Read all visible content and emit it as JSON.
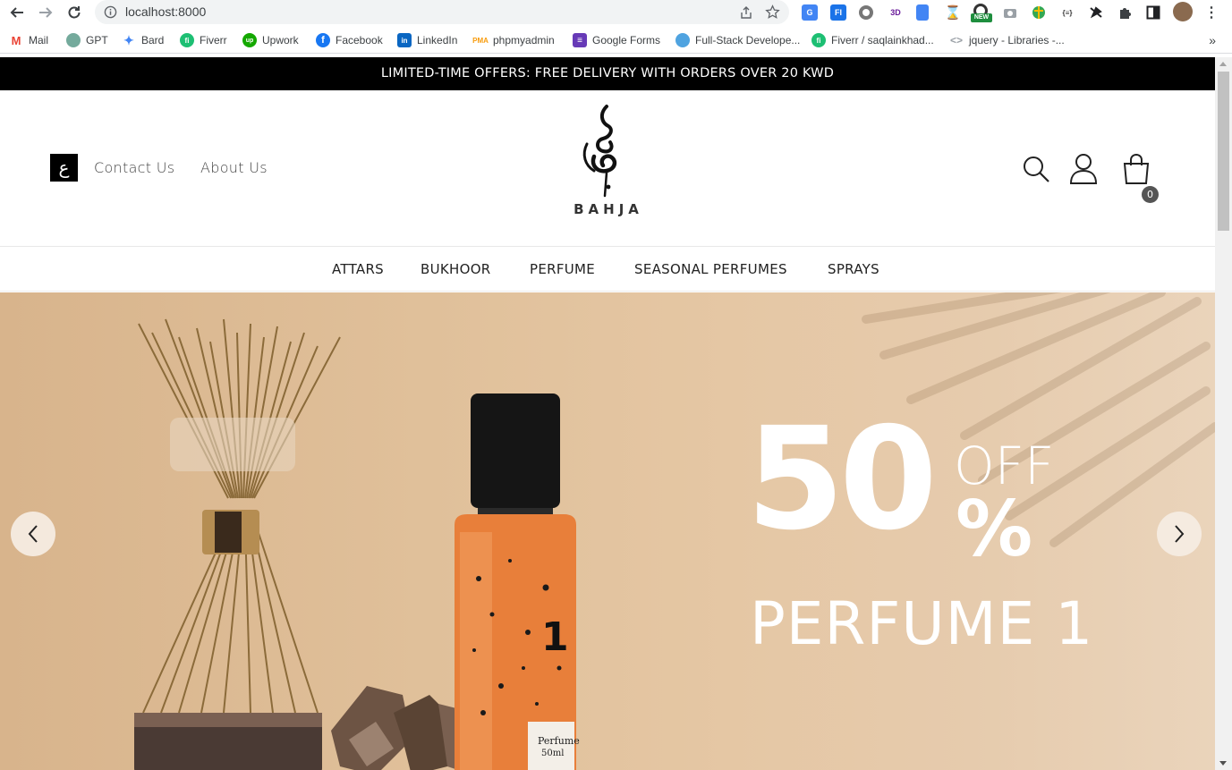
{
  "browser": {
    "url": "localhost:8000",
    "new_badge": "NEW",
    "bookmarks": [
      {
        "label": "Mail",
        "icon": "gmail-icon",
        "color": "#ea4335"
      },
      {
        "label": "GPT",
        "icon": "chatgpt-icon",
        "color": "#74aa9c"
      },
      {
        "label": "Bard",
        "icon": "bard-icon",
        "color": "#4285f4"
      },
      {
        "label": "Fiverr",
        "icon": "fiverr-icon",
        "color": "#1dbf73"
      },
      {
        "label": "Upwork",
        "icon": "upwork-icon",
        "color": "#14a800"
      },
      {
        "label": "Facebook",
        "icon": "facebook-icon",
        "color": "#1877f2"
      },
      {
        "label": "LinkedIn",
        "icon": "linkedin-icon",
        "color": "#0a66c2"
      },
      {
        "label": "phpmyadmin",
        "icon": "phpmyadmin-icon",
        "color": "#f89c0e"
      },
      {
        "label": "Google Forms",
        "icon": "google-forms-icon",
        "color": "#673ab7"
      },
      {
        "label": "Full-Stack Develope...",
        "icon": "cloud-icon",
        "color": "#4fa3e0"
      },
      {
        "label": "Fiverr / saqlainkhad...",
        "icon": "fiverr-icon",
        "color": "#1dbf73"
      },
      {
        "label": "jquery - Libraries -...",
        "icon": "code-icon",
        "color": "#e8710a"
      }
    ]
  },
  "site": {
    "promo": "LIMITED-TIME OFFERS: FREE DELIVERY WITH ORDERS OVER 20 KWD",
    "lang_button": "ع",
    "top_links": [
      "Contact Us",
      "About Us"
    ],
    "brand": "BAHJA",
    "cart_count": "0",
    "categories": [
      "ATTARS",
      "BUKHOOR",
      "PERFUME",
      "SEASONAL PERFUMES",
      "SPRAYS"
    ],
    "hero": {
      "big_number": "50",
      "off": "OFF",
      "percent": "%",
      "product": "PERFUME 1",
      "bottle_number": "1",
      "bottle_label_line1": "Perfume",
      "bottle_label_line2": "50ml"
    }
  }
}
